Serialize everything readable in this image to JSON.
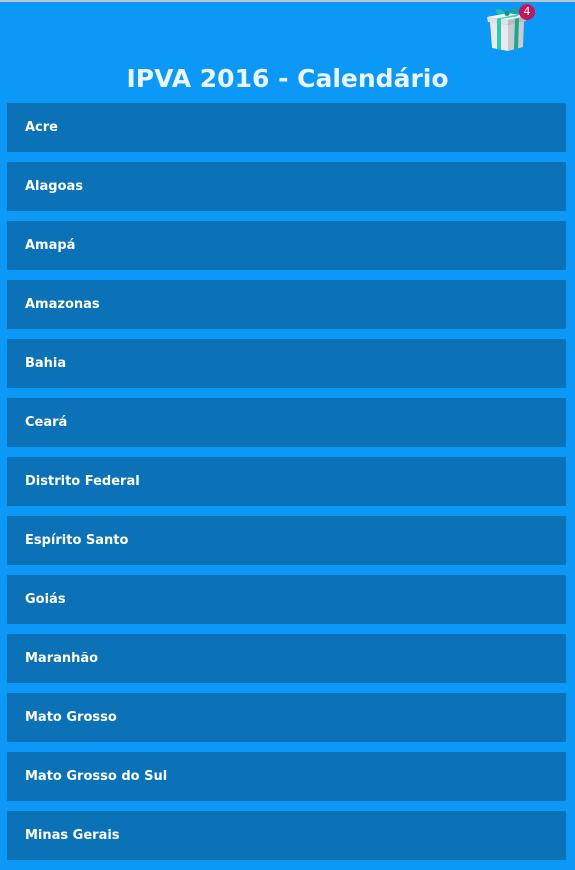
{
  "header": {
    "title": "IPVA 2016 - Calendário",
    "gift_badge_count": "4",
    "gift_icon": "gift-box-icon"
  },
  "colors": {
    "background": "#0c98f7",
    "item_background": "#0b72b8",
    "badge": "#c2185b",
    "text": "#ffffff"
  },
  "states": [
    "Acre",
    "Alagoas",
    "Amapá",
    "Amazonas",
    "Bahia",
    "Ceará",
    "Distrito Federal",
    "Espírito Santo",
    "Goiás",
    "Maranhão",
    "Mato Grosso",
    "Mato Grosso do Sul",
    "Minas Gerais"
  ]
}
